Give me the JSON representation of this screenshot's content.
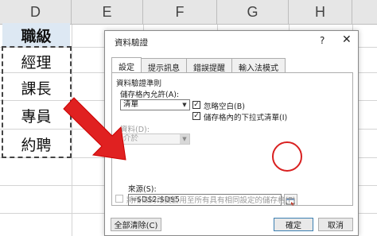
{
  "sheet": {
    "columns": [
      "D",
      "E",
      "F",
      "G",
      "H"
    ],
    "cells": [
      "職級",
      "經理",
      "課長",
      "專員",
      "約聘"
    ]
  },
  "dialog": {
    "title": "資料驗證",
    "help": "?",
    "close": "✕",
    "tabs": [
      "設定",
      "提示訊息",
      "錯誤提醒",
      "輸入法模式"
    ],
    "section_title": "資料驗證準則",
    "allow_label": "儲存格內允許(A):",
    "allow_value": "清單",
    "ignore_blank_label": "忽略空白(B)",
    "ignore_blank_checked": true,
    "dropdown_label": "儲存格內的下拉式清單(I)",
    "dropdown_checked": true,
    "data_label": "資料(D):",
    "data_value": "介於",
    "source_label": "來源(S):",
    "source_value": "=$D$2:$D$5",
    "apply_all_label": "將所做的改變套用至所有具有相同設定的儲存格(P)",
    "apply_all_checked": false,
    "clear_all_button": "全部清除(C)",
    "ok_button": "確定",
    "cancel_button": "取消"
  }
}
